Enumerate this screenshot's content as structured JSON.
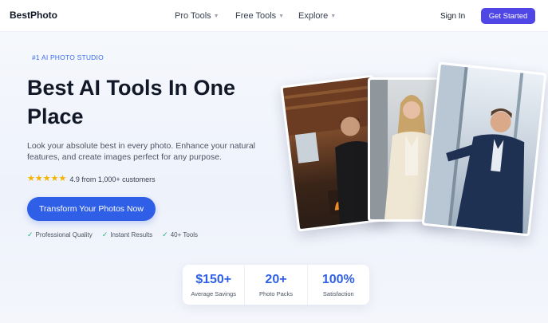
{
  "nav": {
    "logo": "BestPhoto",
    "links": [
      "Pro Tools",
      "Free Tools",
      "Explore"
    ],
    "signin": "Sign In",
    "cta": "Get Started"
  },
  "hero": {
    "eyebrow": "#1 AI PHOTO STUDIO",
    "headline": "Best AI Tools In One Place",
    "subtext": "Look your absolute best in every photo. Enhance your natural features, and create images perfect for any purpose.",
    "rating": {
      "stars": 5,
      "text": "4.9 from 1,000+ customers"
    },
    "button": "Transform Your Photos Now",
    "features": [
      "Professional Quality",
      "Instant Results",
      "40+ Tools"
    ]
  },
  "stats": [
    {
      "value": "$150+",
      "label": "Average Savings"
    },
    {
      "value": "20+",
      "label": "Photo Packs"
    },
    {
      "value": "100%",
      "label": "Satisfaction"
    }
  ],
  "colors": {
    "accent": "#2f5fe6",
    "cta": "#4f46e5",
    "check": "#22b37a",
    "star": "#f5b301"
  }
}
